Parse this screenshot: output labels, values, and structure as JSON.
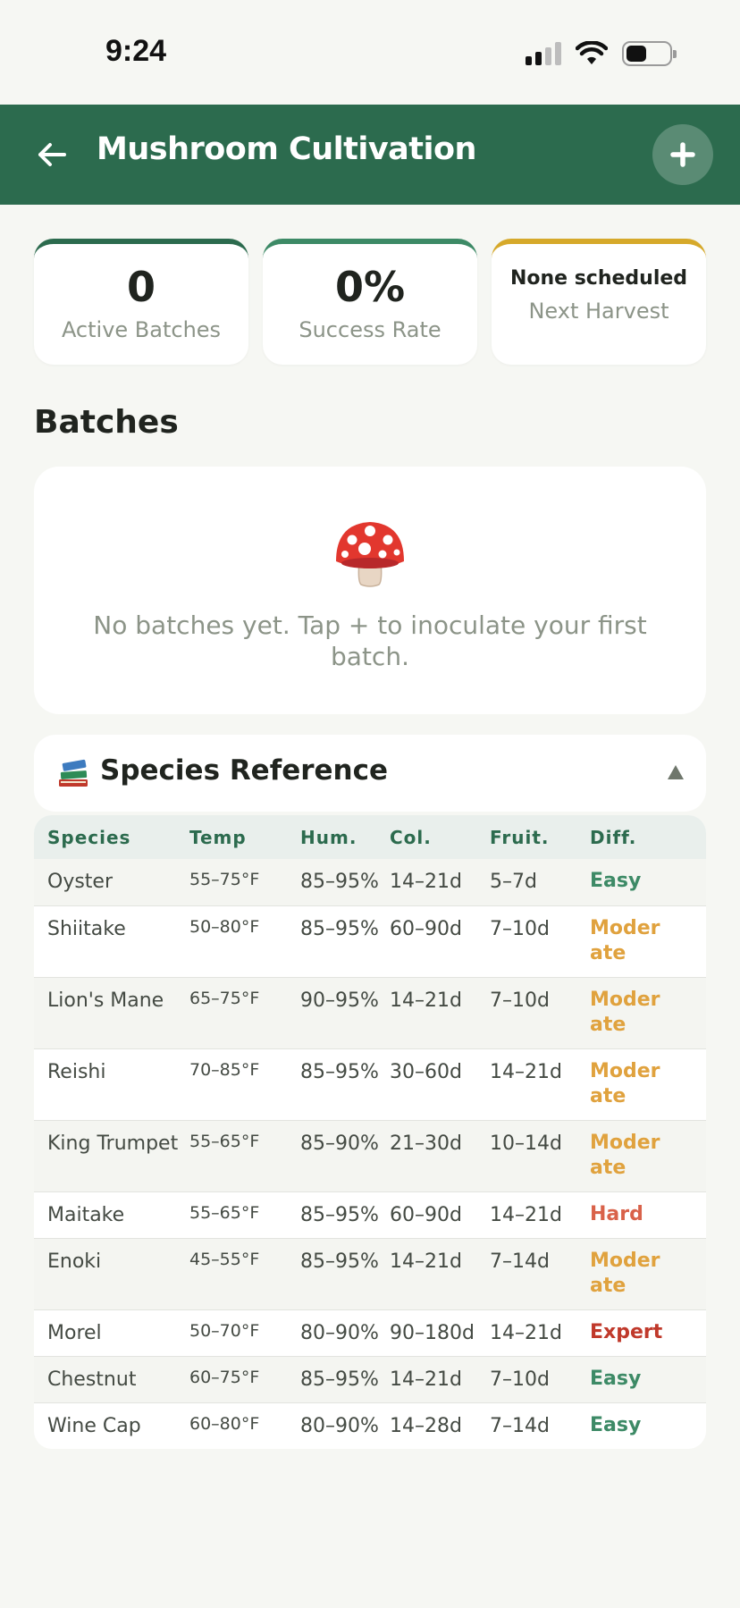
{
  "status": {
    "time": "9:24"
  },
  "app_bar": {
    "title": "Mushroom Cultivation"
  },
  "stats": [
    {
      "value": "0",
      "label": "Active Batches"
    },
    {
      "value": "0%",
      "label": "Success Rate"
    },
    {
      "value": "None scheduled",
      "label": "Next Harvest"
    }
  ],
  "batches": {
    "title": "Batches",
    "empty_text": "No batches yet. Tap + to inoculate your first batch."
  },
  "species_reference": {
    "title": "Species Reference",
    "columns": [
      "Species",
      "Temp",
      "Hum.",
      "Col.",
      "Fruit.",
      "Diff."
    ],
    "rows": [
      {
        "species": "Oyster",
        "temp": "55–75°F",
        "hum": "85–95%",
        "col": "14–21d",
        "fruit": "5–7d",
        "diff": "Easy"
      },
      {
        "species": "Shiitake",
        "temp": "50–80°F",
        "hum": "85–95%",
        "col": "60–90d",
        "fruit": "7–10d",
        "diff": "Moderate"
      },
      {
        "species": "Lion's Mane",
        "temp": "65–75°F",
        "hum": "90–95%",
        "col": "14–21d",
        "fruit": "7–10d",
        "diff": "Moderate"
      },
      {
        "species": "Reishi",
        "temp": "70–85°F",
        "hum": "85–95%",
        "col": "30–60d",
        "fruit": "14–21d",
        "diff": "Moderate"
      },
      {
        "species": "King Trumpet",
        "temp": "55–65°F",
        "hum": "85–90%",
        "col": "21–30d",
        "fruit": "10–14d",
        "diff": "Moderate"
      },
      {
        "species": "Maitake",
        "temp": "55–65°F",
        "hum": "85–95%",
        "col": "60–90d",
        "fruit": "14–21d",
        "diff": "Hard"
      },
      {
        "species": "Enoki",
        "temp": "45–55°F",
        "hum": "85–95%",
        "col": "14–21d",
        "fruit": "7–14d",
        "diff": "Moderate"
      },
      {
        "species": "Morel",
        "temp": "50–70°F",
        "hum": "80–90%",
        "col": "90–180d",
        "fruit": "14–21d",
        "diff": "Expert"
      },
      {
        "species": "Chestnut",
        "temp": "60–75°F",
        "hum": "85–95%",
        "col": "14–21d",
        "fruit": "7–10d",
        "diff": "Easy"
      },
      {
        "species": "Wine Cap",
        "temp": "60–80°F",
        "hum": "80–90%",
        "col": "14–28d",
        "fruit": "7–14d",
        "diff": "Easy"
      }
    ]
  },
  "colors": {
    "primary": "#2c6b4e",
    "accent_gold": "#d6a92a",
    "easy": "#3d8a66",
    "moderate": "#e0a23e",
    "hard": "#d9624a",
    "expert": "#c0392b"
  },
  "icons": [
    "back-arrow-icon",
    "plus-icon",
    "mushroom-icon",
    "books-icon",
    "collapse-triangle-icon",
    "signal-icon",
    "wifi-icon",
    "battery-icon"
  ]
}
